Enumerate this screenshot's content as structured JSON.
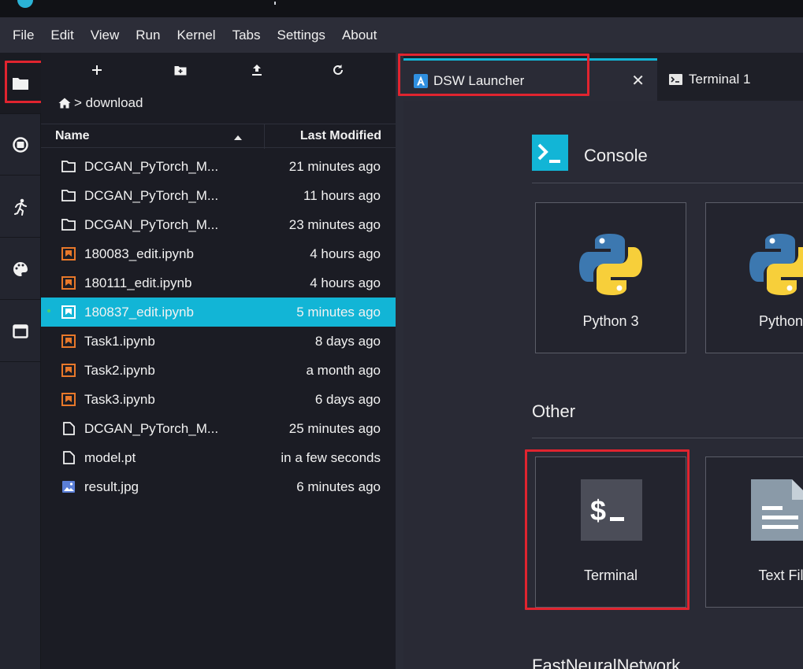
{
  "menubar": {
    "items": [
      "File",
      "Edit",
      "View",
      "Run",
      "Kernel",
      "Tabs",
      "Settings",
      "About"
    ]
  },
  "left_sidebar": {
    "icons": [
      "folder-icon",
      "stop-circle-icon",
      "running-icon",
      "palette-icon",
      "tab-window-icon"
    ]
  },
  "file_browser": {
    "toolbar": {
      "new_launcher_icon": "plus-icon",
      "new_folder_icon": "new-folder-icon",
      "upload_icon": "upload-icon",
      "refresh_icon": "refresh-icon"
    },
    "breadcrumb": {
      "home_icon": "home-icon",
      "path": "> download"
    },
    "columns": {
      "name": "Name",
      "modified": "Last Modified"
    },
    "files": [
      {
        "name": "DCGAN_PyTorch_M...",
        "modified": "21 minutes ago",
        "type": "folder"
      },
      {
        "name": "DCGAN_PyTorch_M...",
        "modified": "11 hours ago",
        "type": "folder"
      },
      {
        "name": "DCGAN_PyTorch_M...",
        "modified": "23 minutes ago",
        "type": "folder"
      },
      {
        "name": "180083_edit.ipynb",
        "modified": "4 hours ago",
        "type": "notebook"
      },
      {
        "name": "180111_edit.ipynb",
        "modified": "4 hours ago",
        "type": "notebook"
      },
      {
        "name": "180837_edit.ipynb",
        "modified": "5 minutes ago",
        "type": "notebook",
        "selected": true
      },
      {
        "name": "Task1.ipynb",
        "modified": "8 days ago",
        "type": "notebook"
      },
      {
        "name": "Task2.ipynb",
        "modified": "a month ago",
        "type": "notebook"
      },
      {
        "name": "Task3.ipynb",
        "modified": "6 days ago",
        "type": "notebook"
      },
      {
        "name": "DCGAN_PyTorch_M...",
        "modified": "25 minutes ago",
        "type": "file"
      },
      {
        "name": "model.pt",
        "modified": "in a few seconds",
        "type": "file"
      },
      {
        "name": "result.jpg",
        "modified": "6 minutes ago",
        "type": "image"
      }
    ]
  },
  "tabs": [
    {
      "label": "DSW Launcher",
      "icon": "launcher-icon",
      "active": true,
      "close": "✕"
    },
    {
      "label": "Terminal 1",
      "icon": "terminal-tab-icon",
      "active": false
    }
  ],
  "launcher": {
    "console": {
      "title": "Console",
      "cards": [
        {
          "label": "Python 3"
        },
        {
          "label": "Python"
        }
      ]
    },
    "other": {
      "title": "Other",
      "cards": [
        {
          "label": "Terminal"
        },
        {
          "label": "Text Fil"
        }
      ]
    },
    "next_section": {
      "title": "FastNeuralNetwork"
    }
  },
  "colors": {
    "accent": "#12b5d6",
    "highlight_box": "#e0242f",
    "notebook_orange": "#e8782a",
    "python_blue": "#3c78b0",
    "python_yellow": "#f7cf3a"
  }
}
